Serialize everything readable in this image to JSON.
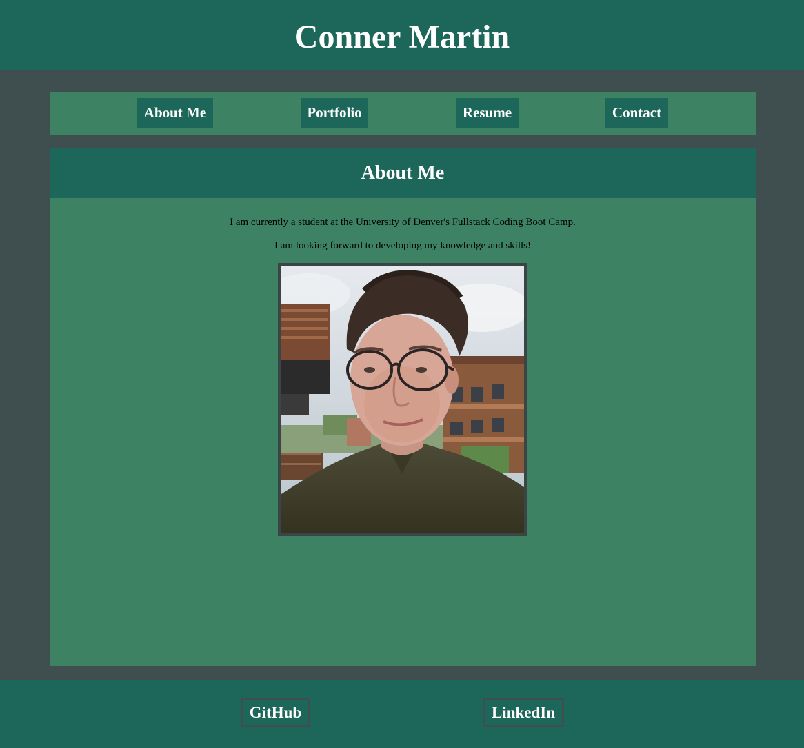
{
  "header": {
    "title": "Conner Martin"
  },
  "nav": {
    "items": [
      {
        "label": "About Me"
      },
      {
        "label": "Portfolio"
      },
      {
        "label": "Resume"
      },
      {
        "label": "Contact"
      }
    ]
  },
  "section": {
    "title": "About Me",
    "paragraphs": [
      "I am currently a student at the University of Denver's Fullstack Coding Boot Camp.",
      "I am looking forward to developing my knowledge and skills!"
    ],
    "photo": {
      "subject": "portrait-photo"
    }
  },
  "footer": {
    "links": [
      {
        "label": "GitHub"
      },
      {
        "label": "LinkedIn"
      }
    ]
  },
  "colors": {
    "page_background": "#3f4f4f",
    "header_background": "#1c6759",
    "panel_background": "#3e8264",
    "text_light": "#ffffff"
  }
}
